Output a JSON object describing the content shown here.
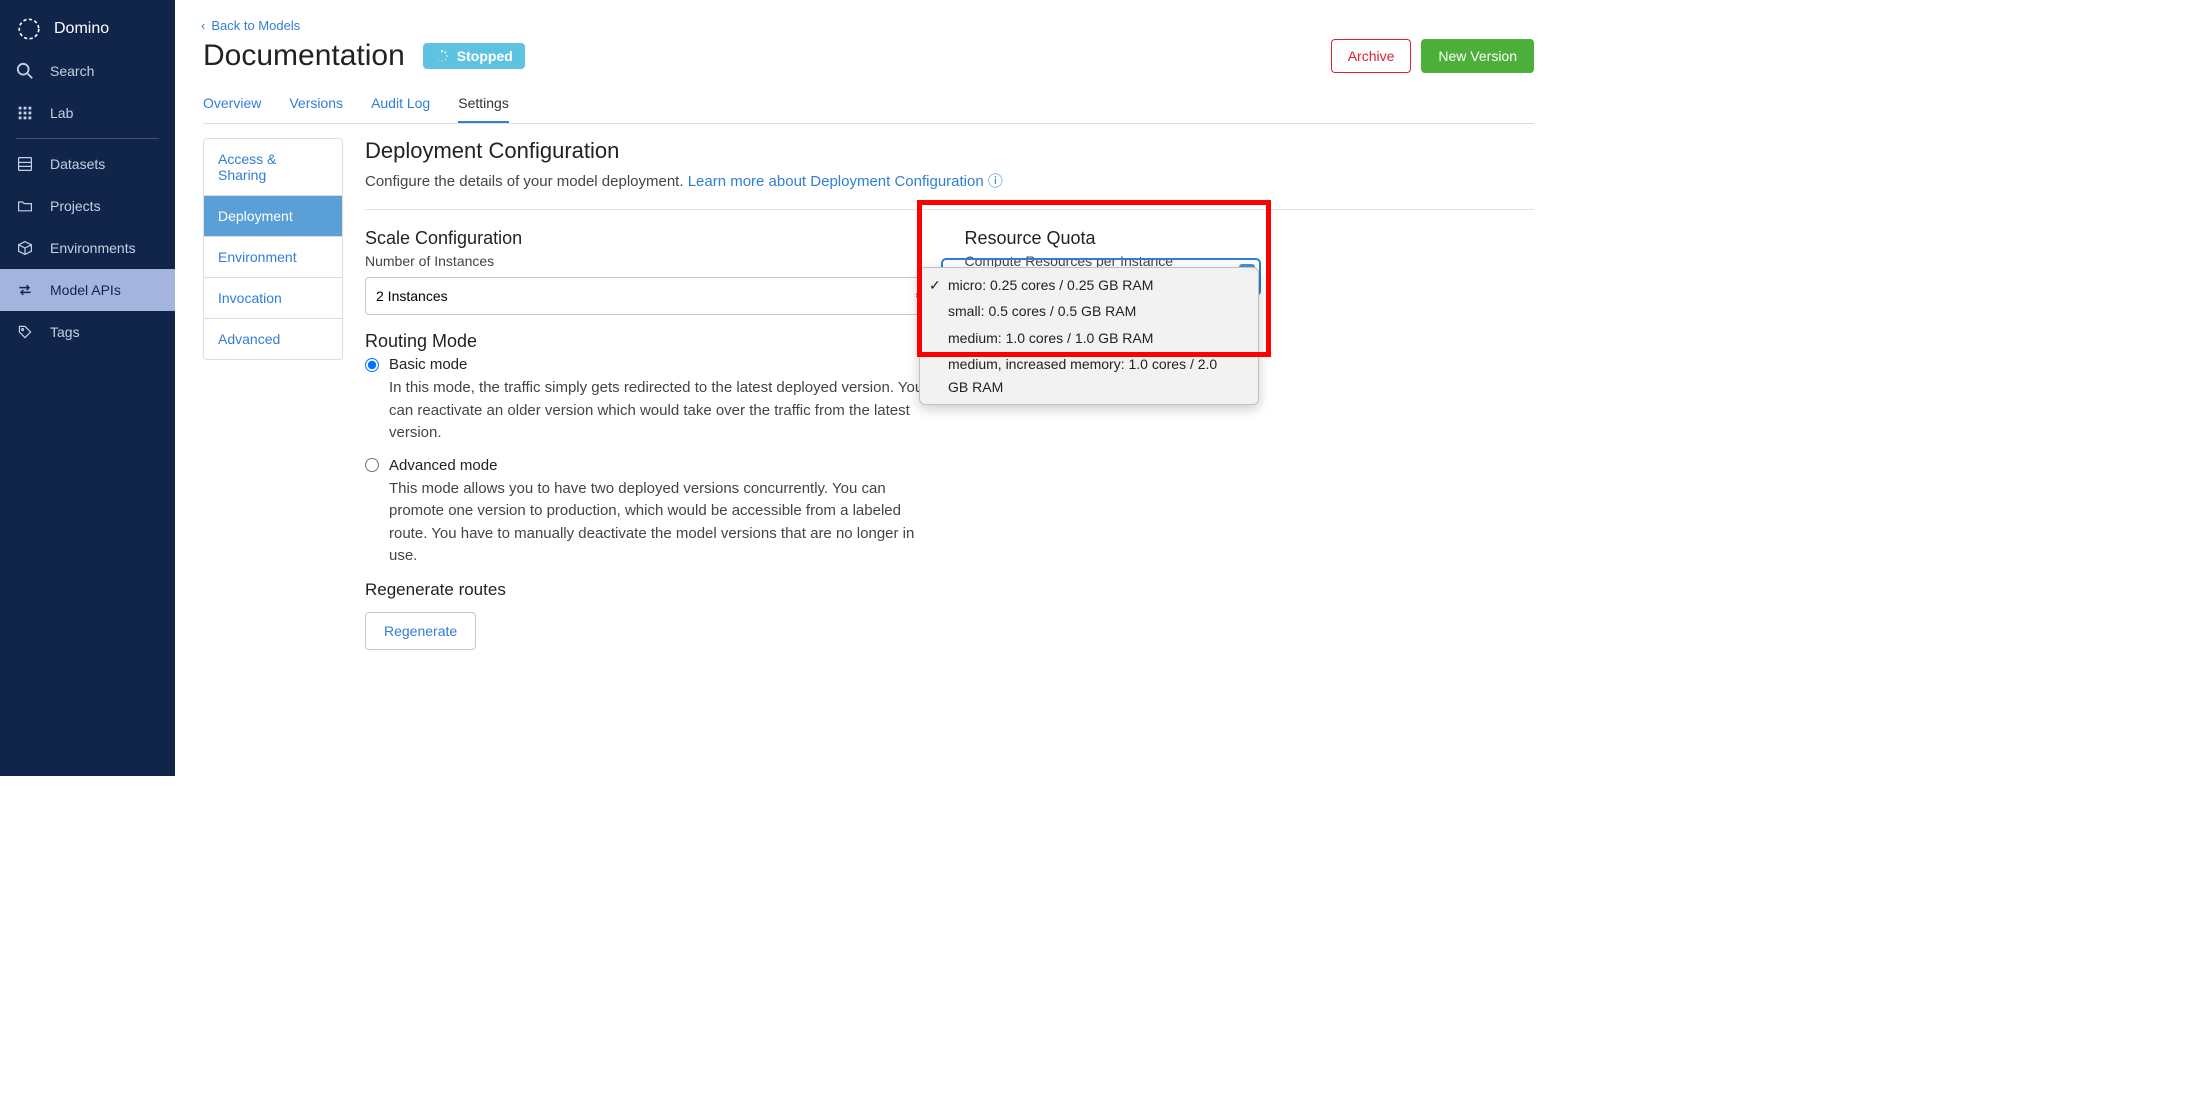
{
  "brand": "Domino",
  "sidebar": {
    "search": "Search",
    "lab": "Lab",
    "datasets": "Datasets",
    "projects": "Projects",
    "environments": "Environments",
    "modelapis": "Model APIs",
    "tags": "Tags"
  },
  "backlink": "Back to Models",
  "page_title": "Documentation",
  "status": "Stopped",
  "buttons": {
    "archive": "Archive",
    "new_version": "New Version"
  },
  "tabs": {
    "overview": "Overview",
    "versions": "Versions",
    "audit": "Audit Log",
    "settings": "Settings"
  },
  "sidenav": {
    "access": "Access & Sharing",
    "deployment": "Deployment",
    "environment": "Environment",
    "invocation": "Invocation",
    "advanced": "Advanced"
  },
  "dc": {
    "title": "Deployment Configuration",
    "sub_pre": "Configure the details of your model deployment. ",
    "sub_link": "Learn more about Deployment Configuration"
  },
  "scale": {
    "title": "Scale Configuration",
    "ni_label": "Number of Instances",
    "ni_value": "2 Instances",
    "routing_title": "Routing Mode",
    "basic_label": "Basic mode",
    "basic_desc": "In this mode, the traffic simply gets redirected to the latest deployed version. You can reactivate an older version which would take over the traffic from the latest version.",
    "adv_label": "Advanced mode",
    "adv_desc": "This mode allows you to have two deployed versions concurrently. You can promote one version to production, which would be accessible from a labeled route. You have to manually deactivate the model versions that are no longer in use.",
    "regen_title": "Regenerate routes",
    "regen_btn": "Regenerate"
  },
  "rq": {
    "title": "Resource Quota",
    "label": "Compute Resources per Instance",
    "selected": "micro: 0.25 cores / 0.25 GB RAM",
    "options": [
      "micro: 0.25 cores / 0.25 GB RAM",
      "small: 0.5 cores / 0.5 GB RAM",
      "medium: 1.0 cores / 1.0 GB RAM",
      "medium, increased memory: 1.0 cores / 2.0 GB RAM"
    ]
  }
}
